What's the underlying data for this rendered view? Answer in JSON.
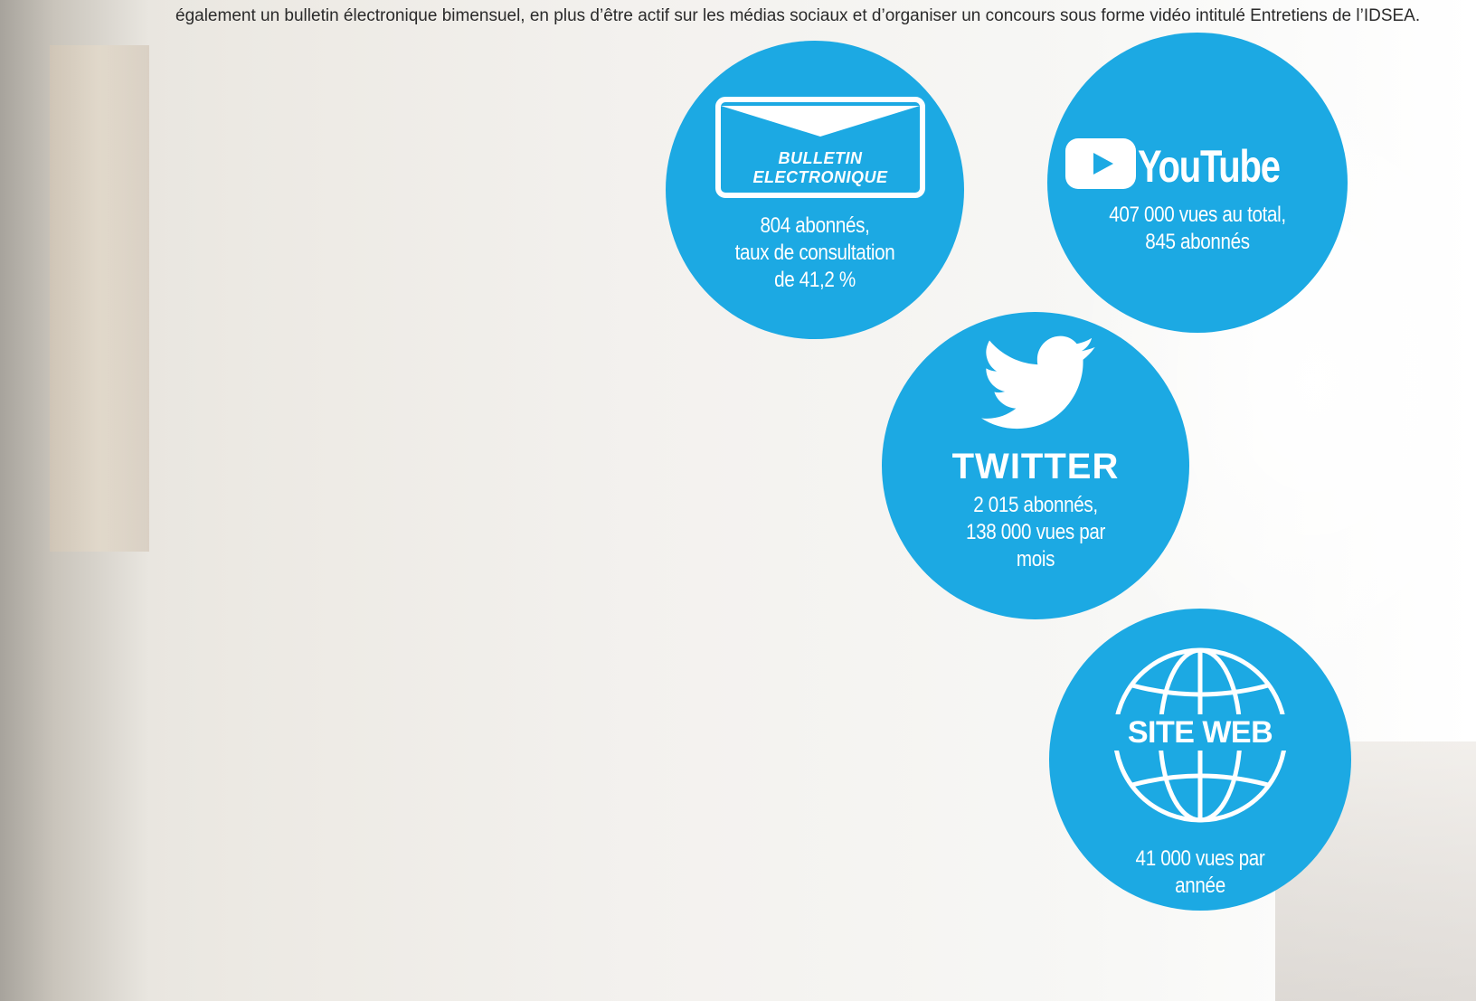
{
  "intro": {
    "text": "également un bulletin électronique bimensuel, en plus d’être actif sur les médias sociaux et d’organiser un concours sous forme vidéo intitulé Entretiens de l’IDSEA."
  },
  "colors": {
    "accent": "#1ca9e3",
    "text": "#2a2a2a"
  },
  "bulletin": {
    "icon": "envelope-icon",
    "label_line1": "BULLETIN",
    "label_line2": "ELECTRONIQUE",
    "stat_line1": "804 abonnés,",
    "stat_line2": "taux de consultation",
    "stat_line3": "de 41,2 %"
  },
  "youtube": {
    "icon": "youtube-play-icon",
    "logo_text": "YouTube",
    "stat_line1": "407 000 vues au total,",
    "stat_line2": "845 abonnés"
  },
  "twitter": {
    "icon": "twitter-bird-icon",
    "title": "TWITTER",
    "stat_line1": "2 015 abonnés,",
    "stat_line2": "138 000 vues par",
    "stat_line3": "mois"
  },
  "siteweb": {
    "icon": "globe-icon",
    "label": "SITE WEB",
    "stat_line1": "41 000 vues par",
    "stat_line2": "année"
  }
}
